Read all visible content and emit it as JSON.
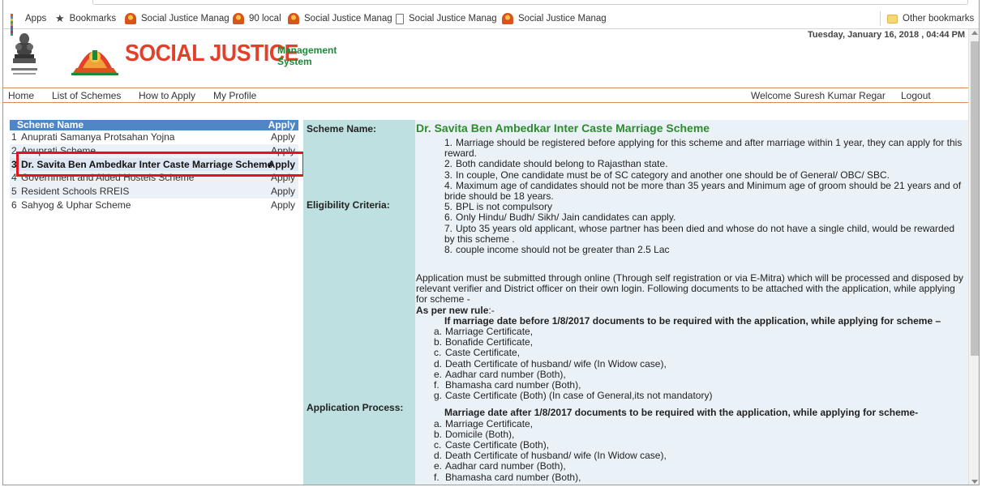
{
  "bookmarks": {
    "items": [
      {
        "label": "Apps",
        "icon": "apps-icon"
      },
      {
        "label": "Bookmarks",
        "icon": "star-icon"
      },
      {
        "label": "Social Justice Manag",
        "icon": "emblem-icon"
      },
      {
        "label": "90 local",
        "icon": "emblem-icon"
      },
      {
        "label": "Social Justice Manag",
        "icon": "emblem-icon"
      },
      {
        "label": "Social Justice Manag",
        "icon": "page-icon"
      },
      {
        "label": "Social Justice Manag",
        "icon": "emblem-icon"
      }
    ],
    "other": "Other bookmarks"
  },
  "header": {
    "datetime": "Tuesday, January 16, 2018 , 04:44 PM",
    "logo_title": "SOCIAL JUSTICE",
    "logo_sub1": "Management",
    "logo_sub2": "System",
    "brand_color": "#e2402a",
    "accent_color": "#1c8a3a"
  },
  "nav": {
    "home": "Home",
    "list": "List of Schemes",
    "how": "How to Apply",
    "profile": "My Profile",
    "welcome": "Welcome Suresh Kumar Regar",
    "logout": "Logout"
  },
  "schemes": {
    "col_name": "Scheme Name",
    "col_apply": "Apply",
    "rows": [
      {
        "num": "1",
        "name": "Anuprati Samanya Protsahan Yojna",
        "apply": "Apply"
      },
      {
        "num": "2",
        "name": "Anuprati Scheme",
        "apply": "Apply"
      },
      {
        "num": "3",
        "name": "Dr. Savita Ben Ambedkar Inter Caste Marriage Scheme",
        "apply": "Apply"
      },
      {
        "num": "4",
        "name": "Government and Aided Hostels Scheme",
        "apply": "Apply"
      },
      {
        "num": "5",
        "name": "Resident Schools RREIS",
        "apply": "Apply"
      },
      {
        "num": "6",
        "name": "Sahyog & Uphar Scheme",
        "apply": "Apply"
      }
    ]
  },
  "detail": {
    "label_scheme": "Scheme Name:",
    "label_eligibility": "Eligibility Criteria:",
    "label_process": "Application Process:",
    "scheme_name": "Dr. Savita Ben Ambedkar Inter Caste Marriage Scheme",
    "criteria": [
      {
        "n": "1.",
        "text": "Marriage should be registered before applying for this scheme and after marriage within 1 year, they can apply for this reward."
      },
      {
        "n": "2.",
        "text": "Both candidate should belong to Rajasthan state."
      },
      {
        "n": "3.",
        "text": "In couple, One candidate must be of SC category and another one should be of General/ OBC/ SBC."
      },
      {
        "n": "4.",
        "text": "Maximum age of candidates should not be more than 35 years and Minimum age of groom should be 21 years and of bride should be 18 years."
      },
      {
        "n": "5.",
        "text": "BPL is not compulsory"
      },
      {
        "n": "6.",
        "text": "Only Hindu/ Budh/ Sikh/ Jain candidates can apply."
      },
      {
        "n": "7.",
        "text": "Upto 35 years old applicant, whose partner has been died and whose do not have a single child, would be rewarded by this scheme ."
      },
      {
        "n": "8.",
        "text": "couple income should not be greater than 2.5 Lac"
      }
    ],
    "process_intro": "Application must be submitted through online (Through self registration or via E-Mitra) which will be processed and disposed by relevant verifier and District officer on their own login. Following documents to be attached with the application, while applying for scheme -",
    "new_rule": "As per new rule",
    "new_rule_suffix": ":-",
    "before_heading": "If marriage date before 1/8/2017 documents to be required with the application, while applying for scheme –",
    "before_docs": [
      {
        "l": "a.",
        "text": "Marriage Certificate,"
      },
      {
        "l": "b.",
        "text": "Bonafide Certificate,"
      },
      {
        "l": "c.",
        "text": "Caste Certificate,"
      },
      {
        "l": "d.",
        "text": "Death Certificate of husband/ wife (In Widow case),"
      },
      {
        "l": "e.",
        "text": "Aadhar card number (Both),"
      },
      {
        "l": "f.",
        "text": "Bhamasha card number (Both),"
      },
      {
        "l": "g.",
        "text": "Caste Certificate (Both) (In case of General,its not mandatory)"
      }
    ],
    "after_heading": "Marriage date after 1/8/2017 documents to be required with the application, while applying for scheme-",
    "after_docs": [
      {
        "l": "a.",
        "text": "Marriage Certificate,"
      },
      {
        "l": "b.",
        "text": "Domicile (Both),"
      },
      {
        "l": "c.",
        "text": "Caste Certificate (Both),"
      },
      {
        "l": "d.",
        "text": "Death Certificate of husband/ wife (In Widow case),"
      },
      {
        "l": "e.",
        "text": "Aadhar card number (Both),"
      },
      {
        "l": "f.",
        "text": "Bhamasha card number (Both),"
      }
    ]
  }
}
